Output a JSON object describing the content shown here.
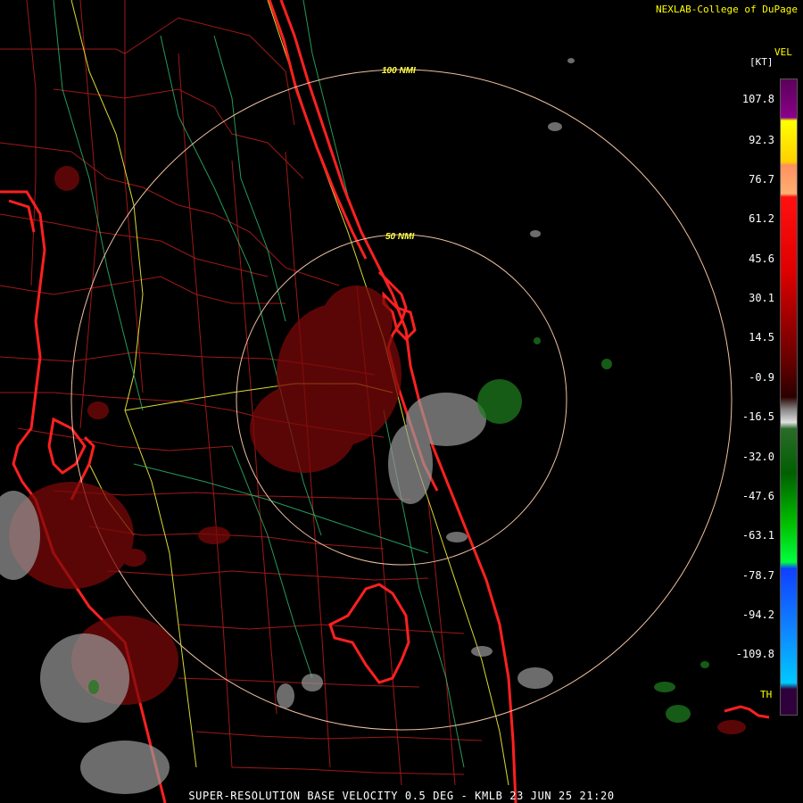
{
  "header": {
    "credit": "NEXLAB-College of DuPage"
  },
  "legend": {
    "product": "VEL",
    "unit": "[KT]",
    "ticks": [
      "107.8",
      "92.3",
      "76.7",
      "61.2",
      "45.6",
      "30.1",
      "14.5",
      "-0.9",
      "-16.5",
      "-32.0",
      "-47.6",
      "-63.1",
      "-78.7",
      "-94.2",
      "-109.8"
    ],
    "th_label": "TH",
    "colors": {
      "top": "#7a007a",
      "yellow": "#ffff00",
      "red": "#ff1010",
      "darkred": "#4a0000",
      "gray": "#bbbbbb",
      "green": "#00c000",
      "blue": "#1060ff",
      "cyan": "#00c8ff"
    }
  },
  "rings": {
    "inner_label": "50 NMI",
    "outer_label": "100 NMI"
  },
  "footer": {
    "caption": "SUPER-RESOLUTION BASE VELOCITY 0.5 DEG - KMLB 23 JUN 25 21:20"
  }
}
